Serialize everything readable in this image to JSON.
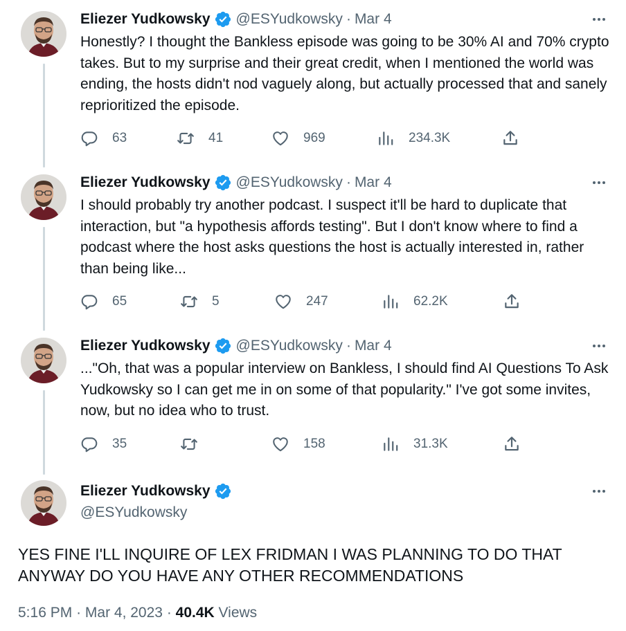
{
  "author": {
    "name": "Eliezer Yudkowsky",
    "handle": "@ESYudkowsky",
    "verified_color": "#1d9bf0"
  },
  "thread": [
    {
      "date": "Mar 4",
      "text": "Honestly?  I thought the Bankless episode was going to be 30% AI and 70% crypto takes.  But to my surprise and their great credit, when I mentioned the world was ending, the hosts didn't nod vaguely along, but actually processed that and sanely reprioritized the episode.",
      "replies": "63",
      "retweets": "41",
      "likes": "969",
      "views": "234.3K"
    },
    {
      "date": "Mar 4",
      "text": "I should probably try another podcast.  I suspect it'll be hard to duplicate that interaction, but \"a hypothesis affords testing\".  But I don't know where to find a podcast where the host asks questions the host is actually interested in, rather than being like...",
      "replies": "65",
      "retweets": "5",
      "likes": "247",
      "views": "62.2K"
    },
    {
      "date": "Mar 4",
      "text": "...\"Oh, that was a popular interview on Bankless, I should find AI Questions To Ask Yudkowsky so I can get me in on some of that popularity.\"  I've got some invites, now, but no idea who to trust.",
      "replies": "35",
      "retweets": "",
      "likes": "158",
      "views": "31.3K"
    }
  ],
  "main_tweet": {
    "text": "YES FINE I'LL INQUIRE OF LEX FRIDMAN I WAS PLANNING TO DO THAT ANYWAY DO YOU HAVE ANY OTHER RECOMMENDATIONS",
    "time": "5:16 PM",
    "date": "Mar 4, 2023",
    "views_count": "40.4K",
    "views_label": "Views"
  },
  "icons": {
    "reply": "reply-icon",
    "retweet": "retweet-icon",
    "like": "heart-icon",
    "views": "views-chart-icon",
    "share": "share-icon",
    "more": "more-dots-icon",
    "verified": "verified-badge-icon"
  },
  "colors": {
    "text_primary": "#0f1419",
    "text_secondary": "#536471",
    "thread_line": "#cfd9de",
    "verified": "#1d9bf0"
  }
}
